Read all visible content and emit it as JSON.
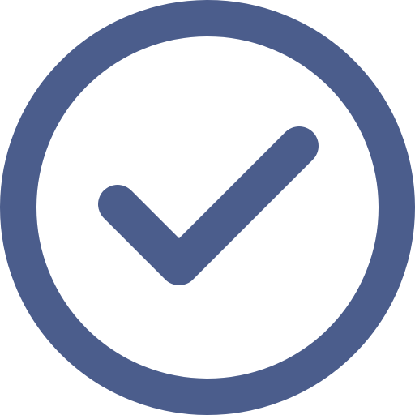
{
  "icon": {
    "name": "check-circle-icon",
    "color": "#4b5d8c",
    "background": "#ffffff"
  }
}
